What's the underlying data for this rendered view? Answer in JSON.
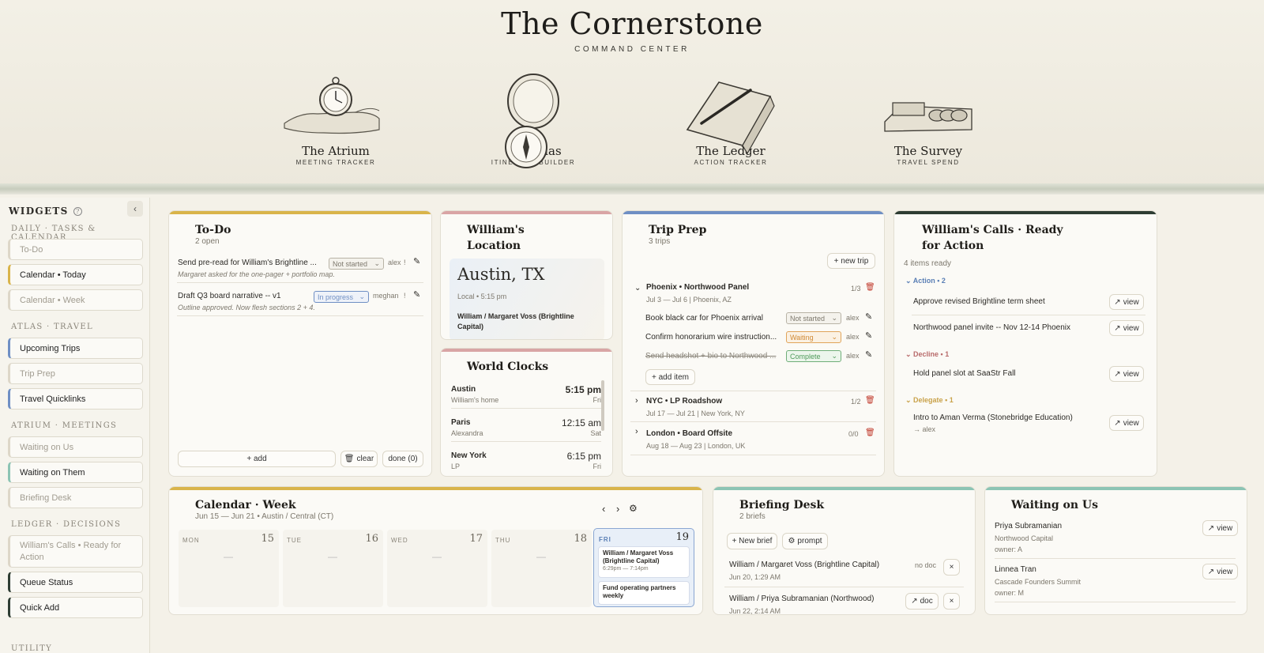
{
  "header": {
    "title": "The Cornerstone",
    "subtitle": "COMMAND CENTER"
  },
  "nav": [
    {
      "name": "The Atrium",
      "sub": "MEETING TRACKER",
      "icon": "pocket-watch-hand-icon"
    },
    {
      "name": "The Atlas",
      "sub": "ITINERARY BUILDER",
      "icon": "compass-icon"
    },
    {
      "name": "The Ledger",
      "sub": "ACTION TRACKER",
      "icon": "ledger-pen-icon"
    },
    {
      "name": "The Survey",
      "sub": "TRAVEL SPEND",
      "icon": "coins-money-icon"
    }
  ],
  "sidebar": {
    "heading": "WIDGETS",
    "sections": [
      "DAILY · TASKS & CALENDAR",
      "ATLAS · TRAVEL",
      "ATRIUM · MEETINGS",
      "LEDGER · DECISIONS",
      "UTILITY"
    ],
    "items": [
      {
        "label": "To-Do",
        "active": false,
        "accent": "#ddd7c8"
      },
      {
        "label": "Calendar • Today",
        "active": true,
        "accent": "#d9b44a"
      },
      {
        "label": "Calendar • Week",
        "active": false,
        "accent": "#ddd7c8"
      },
      {
        "label": "Upcoming Trips",
        "active": true,
        "accent": "#6f8fc4"
      },
      {
        "label": "Trip Prep",
        "active": false,
        "accent": "#ddd7c8"
      },
      {
        "label": "Travel Quicklinks",
        "active": true,
        "accent": "#6f8fc4"
      },
      {
        "label": "Waiting on Us",
        "active": false,
        "accent": "#ddd7c8"
      },
      {
        "label": "Waiting on Them",
        "active": true,
        "accent": "#8cc4b4"
      },
      {
        "label": "Briefing Desk",
        "active": false,
        "accent": "#ddd7c8"
      },
      {
        "label": "William's Calls • Ready for Action",
        "active": false,
        "accent": "#ddd7c8"
      },
      {
        "label": "Queue Status",
        "active": true,
        "accent": "#2e3d33"
      },
      {
        "label": "Quick Add",
        "active": true,
        "accent": "#2e3d33"
      }
    ]
  },
  "todo": {
    "title": "To-Do",
    "count": "2 open",
    "accent": "#d9b44a",
    "items": [
      {
        "text": "Send pre-read for William's Brightline ...",
        "status": "Not started",
        "owner": "alex",
        "flag": "!",
        "note": "Margaret asked for the one-pager + portfolio map."
      },
      {
        "text": "Draft Q3 board narrative -- v1",
        "status": "In progress",
        "owner": "meghan",
        "flag": "!",
        "note": "Outline approved. Now flesh sections 2 + 4."
      }
    ],
    "add_label": "+ add",
    "clear_label": "clear",
    "done_label": "done (0)"
  },
  "location": {
    "title": "William's Location",
    "accent": "#d9a5a5",
    "city": "Austin, TX",
    "local": "Local • 5:15 pm",
    "meeting": "William / Margaret Voss (Brightline Capital)"
  },
  "clocks": {
    "title": "World Clocks",
    "accent": "#d9a5a5",
    "rows": [
      {
        "city": "Austin",
        "who": "William's home",
        "time": "5:15 pm",
        "day": "Fri"
      },
      {
        "city": "Paris",
        "who": "Alexandra",
        "time": "12:15 am",
        "day": "Sat"
      },
      {
        "city": "New York",
        "who": "LP",
        "time": "6:15 pm",
        "day": "Fri"
      }
    ]
  },
  "trip": {
    "title": "Trip Prep",
    "count": "3 trips",
    "accent": "#6f8fc4",
    "new_label": "+ new trip",
    "trips": [
      {
        "name": "Phoenix • Northwood Panel",
        "meta": "Jul 3 — Jul 6 | Phoenix, AZ",
        "progress": "1/3"
      },
      {
        "name": "NYC • LP Roadshow",
        "meta": "Jul 17 — Jul 21 | New York, NY",
        "progress": "1/2"
      },
      {
        "name": "London • Board Offsite",
        "meta": "Aug 18 — Aug 23 | London, UK",
        "progress": "0/0"
      }
    ],
    "tasks": [
      {
        "text": "Book black car for Phoenix arrival",
        "status": "Not started",
        "owner": "alex"
      },
      {
        "text": "Confirm honorarium wire instruction...",
        "status": "Waiting",
        "owner": "alex"
      },
      {
        "text": "Send headshot + bio to Northwood ...",
        "status": "Complete",
        "owner": "alex"
      }
    ],
    "add_item": "+ add item"
  },
  "calls": {
    "title": "William's Calls · Ready for Action",
    "count": "4 items ready",
    "accent": "#2e3d33",
    "groups": [
      {
        "label": "Action • 2",
        "color": "#5a7fb5",
        "items": [
          "Approve revised Brightline term sheet",
          "Northwood panel invite -- Nov 12-14 Phoenix"
        ]
      },
      {
        "label": "Decline • 1",
        "color": "#b86b6b",
        "items": [
          "Hold panel slot at SaaStr Fall"
        ]
      },
      {
        "label": "Delegate • 1",
        "color": "#c9a24a",
        "items": [
          "Intro to Aman Verma (Stonebridge Education)"
        ]
      }
    ],
    "delegate_to": "→ alex",
    "view_label": "view"
  },
  "week": {
    "title": "Calendar · Week",
    "range": "Jun 15 — Jun 21 • Austin / Central (CT)",
    "accent": "#d9b44a",
    "days": [
      {
        "dow": "MON",
        "date": "15"
      },
      {
        "dow": "TUE",
        "date": "16"
      },
      {
        "dow": "WED",
        "date": "17"
      },
      {
        "dow": "THU",
        "date": "18"
      },
      {
        "dow": "FRI",
        "date": "19"
      }
    ],
    "empty": "—",
    "events": [
      {
        "title": "William / Margaret Voss (Brightline Capital)",
        "time": "6:29pm — 7:14pm"
      },
      {
        "title": "Fund operating partners weekly",
        "time": ""
      }
    ]
  },
  "briefing": {
    "title": "Briefing Desk",
    "count": "2 briefs",
    "accent": "#8cc4b4",
    "new_label": "+ New brief",
    "prompt_label": "prompt",
    "rows": [
      {
        "title": "William / Margaret Voss (Brightline Capital)",
        "date": "Jun 20, 1:29 AM",
        "doc": "no doc"
      },
      {
        "title": "William / Priya Subramanian (Northwood)",
        "date": "Jun 22, 2:14 AM",
        "doc": "doc"
      }
    ]
  },
  "waiting": {
    "title": "Waiting on Us",
    "accent": "#8cc4b4",
    "view_label": "view",
    "rows": [
      {
        "name": "Priya Subramanian",
        "org": "Northwood Capital",
        "owner": "owner: A"
      },
      {
        "name": "Linnea Tran",
        "org": "Cascade Founders Summit",
        "owner": "owner: M"
      }
    ]
  }
}
